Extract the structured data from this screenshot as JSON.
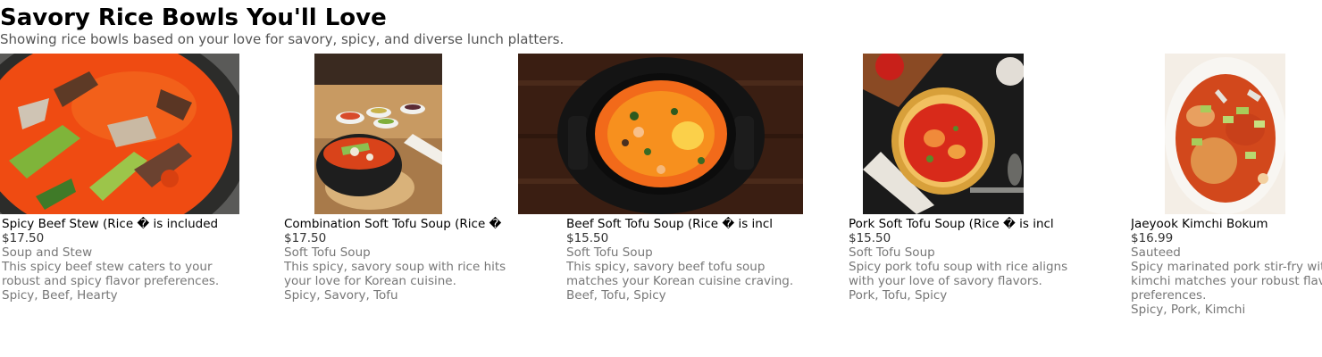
{
  "header": {
    "title": "Savory Rice Bowls You'll Love",
    "subtitle": "Showing rice bowls based on your love for savory, spicy, and diverse lunch platters."
  },
  "items": [
    {
      "name": "Spicy Beef Stew (Rice � is included",
      "price": "$17.50",
      "category": "Soup and Stew",
      "description": "This spicy beef stew caters to your robust and spicy flavor preferences.",
      "tags": "Spicy, Beef, Hearty",
      "image_icon": "spicy-beef-stew-photo"
    },
    {
      "name": "Combination Soft Tofu Soup (Rice �",
      "price": "$17.50",
      "category": "Soft Tofu Soup",
      "description": "This spicy, savory soup with rice hits your love for Korean cuisine.",
      "tags": "Spicy, Savory, Tofu",
      "image_icon": "combination-tofu-soup-photo"
    },
    {
      "name": "Beef Soft Tofu Soup (Rice � is incl",
      "price": "$15.50",
      "category": "Soft Tofu Soup",
      "description": "This spicy, savory beef tofu soup matches your Korean cuisine craving.",
      "tags": "Beef, Tofu, Spicy",
      "image_icon": "beef-tofu-soup-photo"
    },
    {
      "name": "Pork Soft Tofu Soup (Rice � is incl",
      "price": "$15.50",
      "category": "Soft Tofu Soup",
      "description": "Spicy pork tofu soup with rice aligns with your love of savory flavors.",
      "tags": "Pork, Tofu, Spicy",
      "image_icon": "pork-tofu-soup-photo"
    },
    {
      "name": "Jaeyook Kimchi Bokum",
      "price": "$16.99",
      "category": "Sauteed",
      "description": "Spicy marinated pork stir-fry with kimchi matches your robust flavor preferences.",
      "tags": "Spicy, Pork, Kimchi",
      "image_icon": "jaeyook-kimchi-bokum-photo"
    }
  ],
  "colors": {
    "stew_red": "#f04a10",
    "broth_orange": "#f26a1a",
    "pot_black": "#1c1c1c",
    "wood_dark": "#3a1e12",
    "text_secondary": "#777777"
  }
}
